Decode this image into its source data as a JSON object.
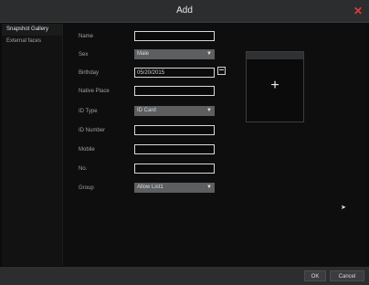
{
  "window": {
    "title": "Add"
  },
  "sidebar": {
    "items": [
      {
        "label": "Snapshot Gallery"
      },
      {
        "label": "External faces"
      }
    ]
  },
  "form": {
    "fields": [
      {
        "label": "Name",
        "value": ""
      },
      {
        "label": "Sex",
        "value": "Male"
      },
      {
        "label": "Birthday",
        "value": "05/20/2015"
      },
      {
        "label": "Native Place",
        "value": ""
      },
      {
        "label": "ID Type",
        "value": "ID Card"
      },
      {
        "label": "ID Number",
        "value": ""
      },
      {
        "label": "Mobile",
        "value": ""
      },
      {
        "label": "No.",
        "value": ""
      },
      {
        "label": "Group",
        "value": "Allow List1"
      }
    ]
  },
  "photo": {
    "add_symbol": "+"
  },
  "footer": {
    "ok_label": "OK",
    "cancel_label": "Cancel"
  },
  "icons": {
    "close": "close-icon",
    "calendar": "calendar-icon",
    "plus": "plus-icon",
    "caret": "chevron-down-icon",
    "cursor": "mouse-cursor-icon"
  },
  "colors": {
    "accent_close": "#e43a3a"
  }
}
